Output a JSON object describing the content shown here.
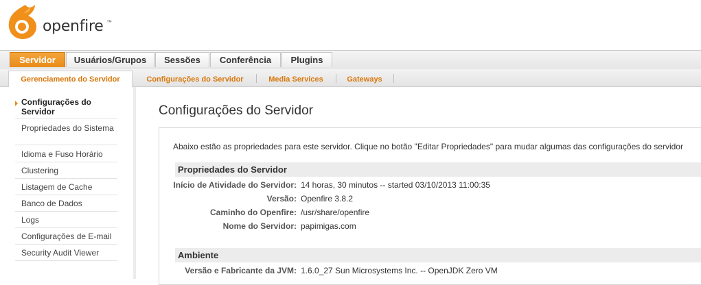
{
  "brand": {
    "name": "openfire",
    "tm": "™"
  },
  "main_tabs": [
    {
      "label": "Servidor",
      "active": true
    },
    {
      "label": "Usuários/Grupos",
      "active": false
    },
    {
      "label": "Sessões",
      "active": false
    },
    {
      "label": "Conferência",
      "active": false
    },
    {
      "label": "Plugins",
      "active": false
    }
  ],
  "sub_tabs": [
    {
      "label": "Gerenciamento do Servidor",
      "active": true
    },
    {
      "label": "Configurações do Servidor",
      "active": false
    },
    {
      "label": "Media Services",
      "active": false
    },
    {
      "label": "Gateways",
      "active": false
    }
  ],
  "sidebar": {
    "items": [
      {
        "label": "Configurações do Servidor",
        "active": true
      },
      {
        "label": "Propriedades do Sistema",
        "active": false
      },
      {
        "label": "Idioma e Fuso Horário",
        "active": false
      },
      {
        "label": "Clustering",
        "active": false
      },
      {
        "label": "Listagem de Cache",
        "active": false
      },
      {
        "label": "Banco de Dados",
        "active": false
      },
      {
        "label": "Logs",
        "active": false
      },
      {
        "label": "Configurações de E-mail",
        "active": false
      },
      {
        "label": "Security Audit Viewer",
        "active": false
      }
    ]
  },
  "main": {
    "title": "Configurações do Servidor",
    "intro": "Abaixo estão as propriedades para este servidor. Clique no botão \"Editar Propriedades\" para mudar algumas das configurações do servidor",
    "server_section": {
      "heading": "Propriedades do Servidor",
      "rows": [
        {
          "label": "Início de Atividade do Servidor:",
          "value": "14 horas, 30 minutos -- started 03/10/2013 11:00:35"
        },
        {
          "label": "Versão:",
          "value": "Openfire 3.8.2"
        },
        {
          "label": "Caminho do Openfire:",
          "value": "/usr/share/openfire"
        },
        {
          "label": "Nome do Servidor:",
          "value": "papimigas.com"
        }
      ]
    },
    "env_section": {
      "heading": "Ambiente",
      "rows": [
        {
          "label": "Versão e Fabricante da JVM:",
          "value": "1.6.0_27 Sun Microsystems Inc. -- OpenJDK Zero VM"
        }
      ]
    }
  },
  "colors": {
    "accent": "#e88c1a",
    "subtab_text": "#d9770a"
  }
}
